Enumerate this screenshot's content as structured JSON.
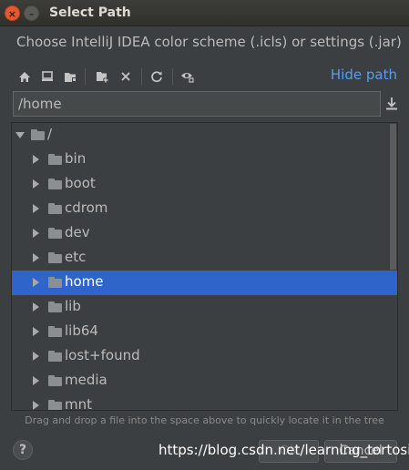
{
  "window": {
    "title": "Select Path",
    "close_glyph": "×",
    "minimize_glyph": "–"
  },
  "description": "Choose IntelliJ IDEA color scheme (.icls) or settings (.jar)",
  "toolbar": {
    "icons": [
      "home-icon",
      "desktop-icon",
      "project-folder-icon",
      "new-folder-icon",
      "delete-icon",
      "refresh-icon",
      "show-hidden-icon"
    ]
  },
  "hide_path_label": "Hide path",
  "path_field": {
    "value": "/home"
  },
  "tree": {
    "root": {
      "label": "/",
      "expanded": true
    },
    "items": [
      {
        "label": "bin"
      },
      {
        "label": "boot"
      },
      {
        "label": "cdrom"
      },
      {
        "label": "dev"
      },
      {
        "label": "etc"
      },
      {
        "label": "home",
        "selected": true
      },
      {
        "label": "lib"
      },
      {
        "label": "lib64"
      },
      {
        "label": "lost+found"
      },
      {
        "label": "media"
      },
      {
        "label": "mnt"
      }
    ]
  },
  "hint": "Drag and drop a file into the space above to quickly locate it in the tree",
  "help_label": "?",
  "buttons": {
    "ok": "OK",
    "cancel": "Cancel"
  },
  "watermark": "https://blog.csdn.net/learning_tortosie",
  "colors": {
    "background": "#3c3f41",
    "selection": "#2f65ca",
    "link": "#589df6",
    "close_button": "#e25a2f"
  }
}
